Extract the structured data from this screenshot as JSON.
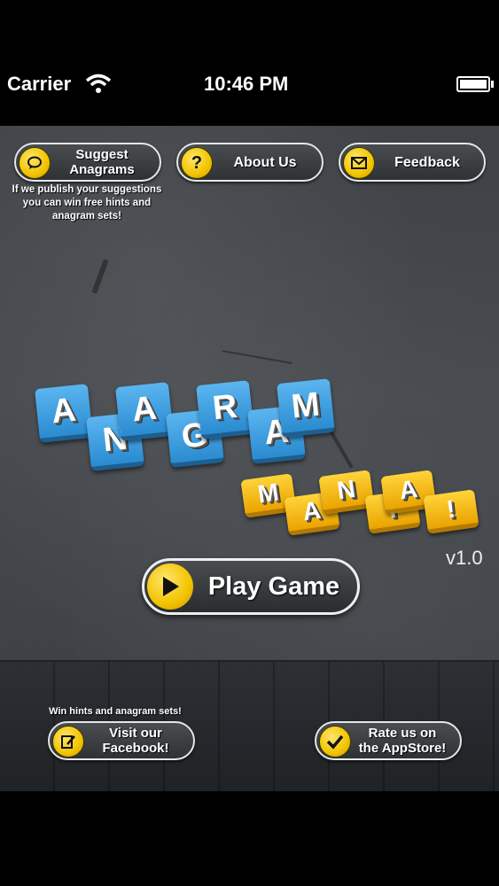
{
  "status_bar": {
    "carrier": "Carrier",
    "time": "10:46 PM"
  },
  "top_buttons": {
    "suggest": {
      "label": "Suggest Anagrams",
      "icon": "speech-bubble-icon"
    },
    "about": {
      "label": "About Us",
      "icon": "question-icon"
    },
    "feedback": {
      "label": "Feedback",
      "icon": "envelope-icon"
    }
  },
  "suggest_note": "If we publish your suggestions you can win free hints and anagram sets!",
  "logo": {
    "word1": [
      "A",
      "N",
      "A",
      "G",
      "R",
      "A",
      "M"
    ],
    "word2": [
      "M",
      "A",
      "N",
      "I",
      "A",
      "!"
    ]
  },
  "version": "v1.0",
  "play_button": {
    "label": "Play Game",
    "icon": "play-icon"
  },
  "facebook": {
    "note": "Win hints and anagram sets!",
    "label": "Visit our Facebook!",
    "icon": "notepad-pencil-icon"
  },
  "rate": {
    "label": "Rate us on the AppStore!",
    "icon": "checkmark-icon"
  },
  "colors": {
    "accent": "#f2c300",
    "tile_blue": "#2a8bd0",
    "tile_yellow": "#eaa300"
  }
}
